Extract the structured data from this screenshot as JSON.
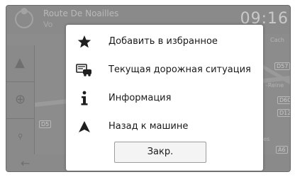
{
  "status": {
    "road_name": "Route De Noailles",
    "road_sub": "Vo",
    "clock": "09:16"
  },
  "map_labels": {
    "cache": "Cach",
    "d57": "D57",
    "reine": "-Reine",
    "d60": "D60",
    "d12": "D12",
    "esnes": "esnes",
    "a6": "A6",
    "d5": "D5"
  },
  "popup": {
    "items": [
      {
        "label": "Добавить в избранное",
        "icon": "star-icon"
      },
      {
        "label": "Текущая дорожная ситуация",
        "icon": "traffic-icon"
      },
      {
        "label": "Информация",
        "icon": "info-icon"
      },
      {
        "label": "Назад к машине",
        "icon": "arrow-up-icon"
      }
    ],
    "close_label": "Закр."
  }
}
